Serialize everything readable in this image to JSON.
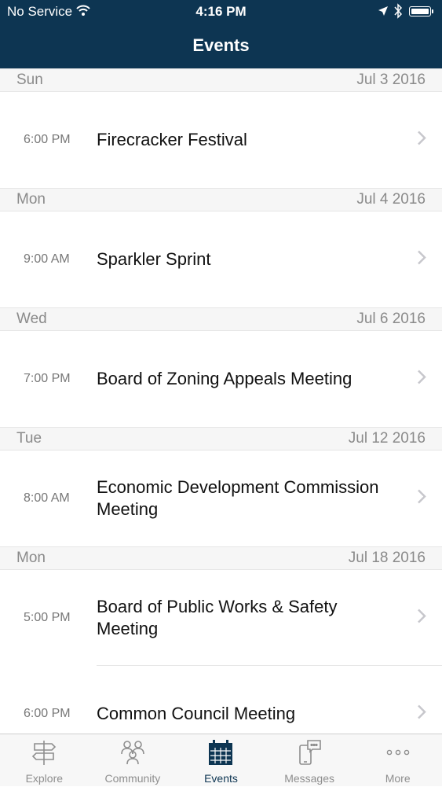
{
  "status_bar": {
    "carrier": "No Service",
    "time": "4:16 PM",
    "icons": [
      "wifi-icon",
      "location-arrow-icon",
      "bluetooth-icon",
      "battery-icon"
    ]
  },
  "header": {
    "title": "Events"
  },
  "sections": [
    {
      "day": "Sun",
      "date": "Jul 3 2016",
      "events": [
        {
          "time": "6:00 PM",
          "title": "Firecracker Festival"
        }
      ]
    },
    {
      "day": "Mon",
      "date": "Jul 4 2016",
      "events": [
        {
          "time": "9:00 AM",
          "title": "Sparkler Sprint"
        }
      ]
    },
    {
      "day": "Wed",
      "date": "Jul 6 2016",
      "events": [
        {
          "time": "7:00 PM",
          "title": "Board of Zoning Appeals Meeting"
        }
      ]
    },
    {
      "day": "Tue",
      "date": "Jul 12 2016",
      "events": [
        {
          "time": "8:00 AM",
          "title": "Economic Development Commission Meeting"
        }
      ]
    },
    {
      "day": "Mon",
      "date": "Jul 18 2016",
      "events": [
        {
          "time": "5:00 PM",
          "title": "Board of Public Works & Safety Meeting"
        },
        {
          "time": "6:00 PM",
          "title": "Common Council Meeting"
        }
      ]
    }
  ],
  "tabs": [
    {
      "label": "Explore",
      "icon": "signpost-icon",
      "active": false
    },
    {
      "label": "Community",
      "icon": "people-icon",
      "active": false
    },
    {
      "label": "Events",
      "icon": "calendar-icon",
      "active": true
    },
    {
      "label": "Messages",
      "icon": "phone-chat-icon",
      "active": false
    },
    {
      "label": "More",
      "icon": "more-dots-icon",
      "active": false
    }
  ],
  "colors": {
    "header_bg": "#0d3552",
    "active_tab": "#0d3552",
    "inactive_tab": "#8e8e8e",
    "section_bg": "#f6f6f6"
  }
}
